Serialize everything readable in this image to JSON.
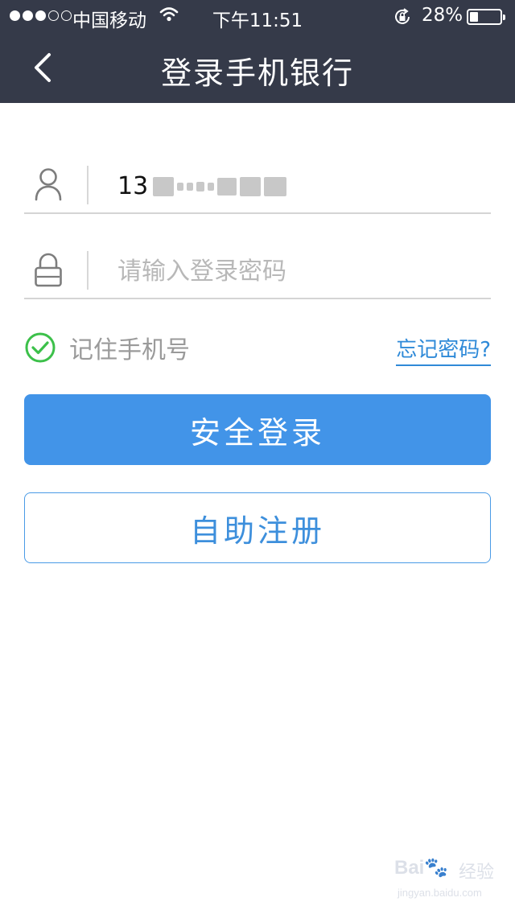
{
  "status_bar": {
    "carrier": "中国移动",
    "time": "下午11:51",
    "battery_percent": "28%",
    "battery_level": 0.28,
    "signal_bars_filled": 3,
    "signal_bars_total": 5
  },
  "nav": {
    "title": "登录手机银行",
    "back_icon": "chevron-left-icon"
  },
  "form": {
    "phone": {
      "icon": "user-icon",
      "value": "13"
    },
    "password": {
      "icon": "lock-icon",
      "placeholder": "请输入登录密码"
    },
    "remember": {
      "icon": "check-circle-icon",
      "label": "记住手机号",
      "checked": true
    },
    "forgot_link": "忘记密码?"
  },
  "buttons": {
    "login": "安全登录",
    "register": "自助注册"
  },
  "watermark": {
    "text": "经验",
    "url": "jingyan.baidu.com"
  },
  "colors": {
    "header_bg": "#353a49",
    "primary": "#4294e8",
    "link": "#2f8ad8",
    "check": "#3cc04a"
  }
}
